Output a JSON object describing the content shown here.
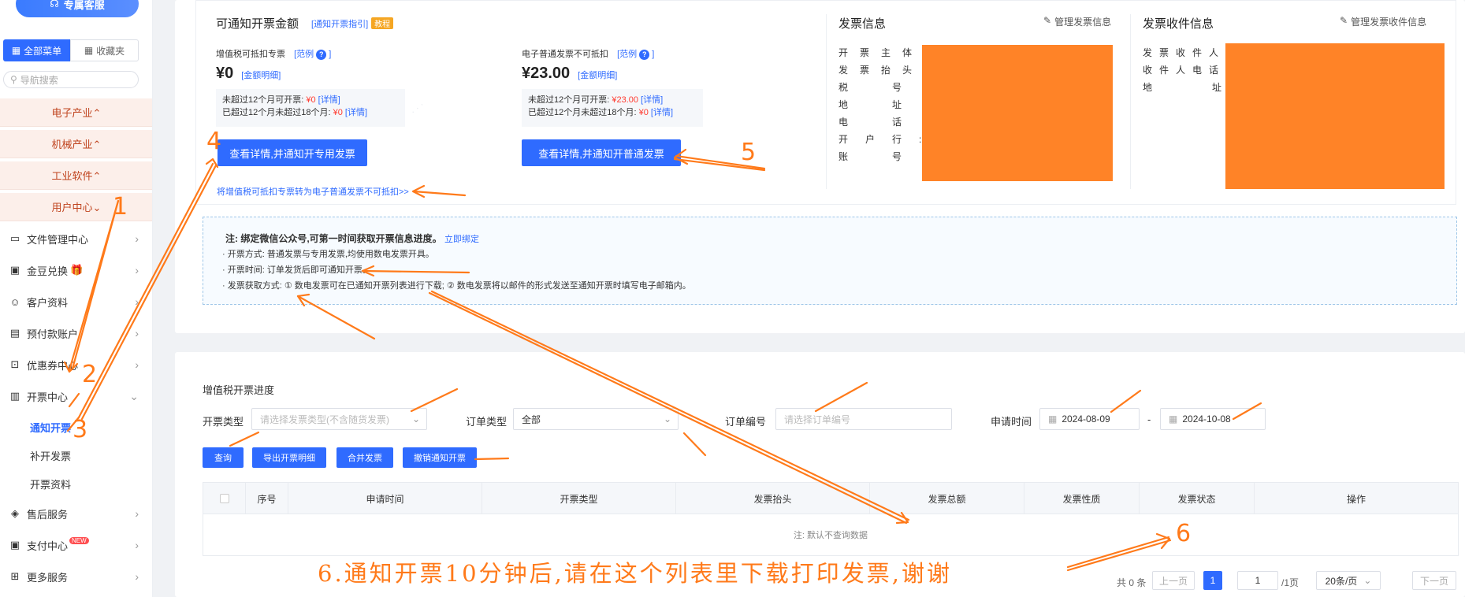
{
  "sidebar": {
    "service_btn": "专属客服",
    "tab_all": "全部菜单",
    "tab_fav": "收藏夹",
    "search_placeholder": "导航搜索",
    "industries": [
      "电子产业⌃",
      "机械产业⌃",
      "工业软件⌃",
      "用户中心⌄"
    ],
    "items": [
      {
        "label": "文件管理中心",
        "icon": "folder-icon"
      },
      {
        "label": "金豆兑换",
        "icon": "coin-icon"
      },
      {
        "label": "客户资料",
        "icon": "user-icon"
      },
      {
        "label": "预付款账户",
        "icon": "wallet-icon"
      },
      {
        "label": "优惠券中心",
        "icon": "coupon-icon"
      },
      {
        "label": "开票中心",
        "icon": "invoice-icon"
      },
      {
        "label": "售后服务",
        "icon": "service-icon"
      },
      {
        "label": "支付中心",
        "icon": "pay-icon"
      },
      {
        "label": "更多服务",
        "icon": "more-icon"
      }
    ],
    "sub_items": [
      "通知开票",
      "补开发票",
      "开票资料"
    ],
    "new_badge": "NEW"
  },
  "amount": {
    "title": "可通知开票金额",
    "guide": "[通知开票指引]",
    "tutorial": "教程",
    "vat": {
      "label": "增值税可抵扣专票",
      "example": "[范例",
      "example_end": "]",
      "amount": "¥0",
      "detail": "[金额明细]",
      "line1_label": "未超过12个月可开票:",
      "line1_value": "¥0",
      "line1_link": "[详情]",
      "line2_label": "已超过12个月未超过18个月:",
      "line2_value": "¥0",
      "line2_link": "[详情]",
      "button": "查看详情,并通知开专用发票"
    },
    "normal": {
      "label": "电子普通发票不可抵扣",
      "example": "[范例",
      "example_end": "]",
      "amount": "¥23.00",
      "detail": "[金额明细]",
      "line1_label": "未超过12个月可开票:",
      "line1_value": "¥23.00",
      "line1_link": "[详情]",
      "line2_label": "已超过12个月未超过18个月:",
      "line2_value": "¥0",
      "line2_link": "[详情]",
      "button": "查看详情,并通知开普通发票"
    },
    "convert_link": "将增值税可抵扣专票转为电子普通发票不可抵扣>>"
  },
  "invoice_info": {
    "title": "发票信息",
    "manage": "管理发票信息",
    "labels": [
      "开票主体:",
      "发票抬头:",
      "税号:",
      "地址:",
      "电话:",
      "开户行:",
      "账号:"
    ]
  },
  "receiver_info": {
    "title": "发票收件信息",
    "manage": "管理发票收件信息",
    "labels": [
      "发票收件人:",
      "收件人电话:",
      "地址:"
    ]
  },
  "note": {
    "head": "注: 绑定微信公众号,可第一时间获取开票信息进度。",
    "bind": "立即绑定",
    "line1": "· 开票方式: 普通发票与专用发票,均使用数电发票开具。",
    "line2": "· 开票时间: 订单发货后即可通知开票。",
    "line3": "· 发票获取方式: ① 数电发票可在已通知开票列表进行下载; ② 数电发票将以邮件的形式发送至通知开票时填写电子邮箱内。"
  },
  "progress": {
    "title": "增值税开票进度",
    "type_label": "开票类型",
    "type_placeholder": "请选择发票类型(不含随货发票)",
    "order_type_label": "订单类型",
    "order_type_value": "全部",
    "order_no_label": "订单编号",
    "order_no_placeholder": "请选择订单编号",
    "date_label": "申请时间",
    "date_from": "2024-08-09",
    "date_sep": "-",
    "date_to": "2024-10-08",
    "buttons": [
      "查询",
      "导出开票明细",
      "合并发票",
      "撤销通知开票"
    ],
    "columns": [
      "序号",
      "申请时间",
      "开票类型",
      "发票抬头",
      "发票总额",
      "发票性质",
      "发票状态",
      "操作"
    ],
    "empty": "注: 默认不查询数据",
    "total": "共 0 条",
    "prev": "上一页",
    "page": "1",
    "page_input": "1",
    "page_total": "/1页",
    "page_size": "20条/页",
    "next": "下一页"
  },
  "annotations": {
    "n1": "1",
    "n2": "2",
    "n3": "3",
    "n4": "4",
    "n5": "5",
    "n6": "6",
    "text": "6.通知开票10分钟后,请在这个列表里下载打印发票,谢谢"
  },
  "colors": {
    "primary": "#2f6bff",
    "annotation": "#ff7a1a",
    "redact": "#ff8327"
  }
}
